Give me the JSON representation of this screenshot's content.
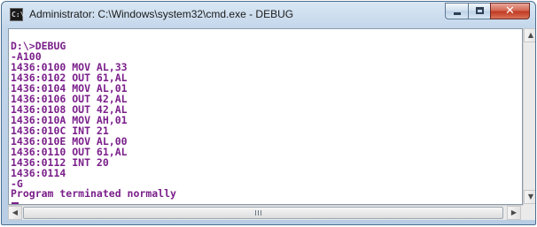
{
  "window": {
    "title": "Administrator: C:\\Windows\\system32\\cmd.exe - DEBUG",
    "app_icon": "cmd-icon",
    "app_icon_text": "C:\\",
    "controls": {
      "minimize": "minimize-icon",
      "maximize": "maximize-icon",
      "close": "close-icon",
      "close_glyph": "✕"
    },
    "colors": {
      "text": "#7a1f8a",
      "console_background": "#ffffff",
      "close_button": "#c23a22"
    }
  },
  "console": {
    "lines": [
      "D:\\>DEBUG",
      "-A100",
      "1436:0100 MOV AL,33",
      "1436:0102 OUT 61,AL",
      "1436:0104 MOV AL,01",
      "1436:0106 OUT 42,AL",
      "1436:0108 OUT 42,AL",
      "1436:010A MOV AH,01",
      "1436:010C INT 21",
      "1436:010E MOV AL,00",
      "1436:0110 OUT 61,AL",
      "1436:0112 INT 20",
      "1436:0114",
      "-G",
      "",
      "Program terminated normally",
      ""
    ]
  },
  "scrollbars": {
    "up_arrow": "▲",
    "down_arrow": "▼",
    "left_arrow": "◀",
    "right_arrow": "▶"
  }
}
